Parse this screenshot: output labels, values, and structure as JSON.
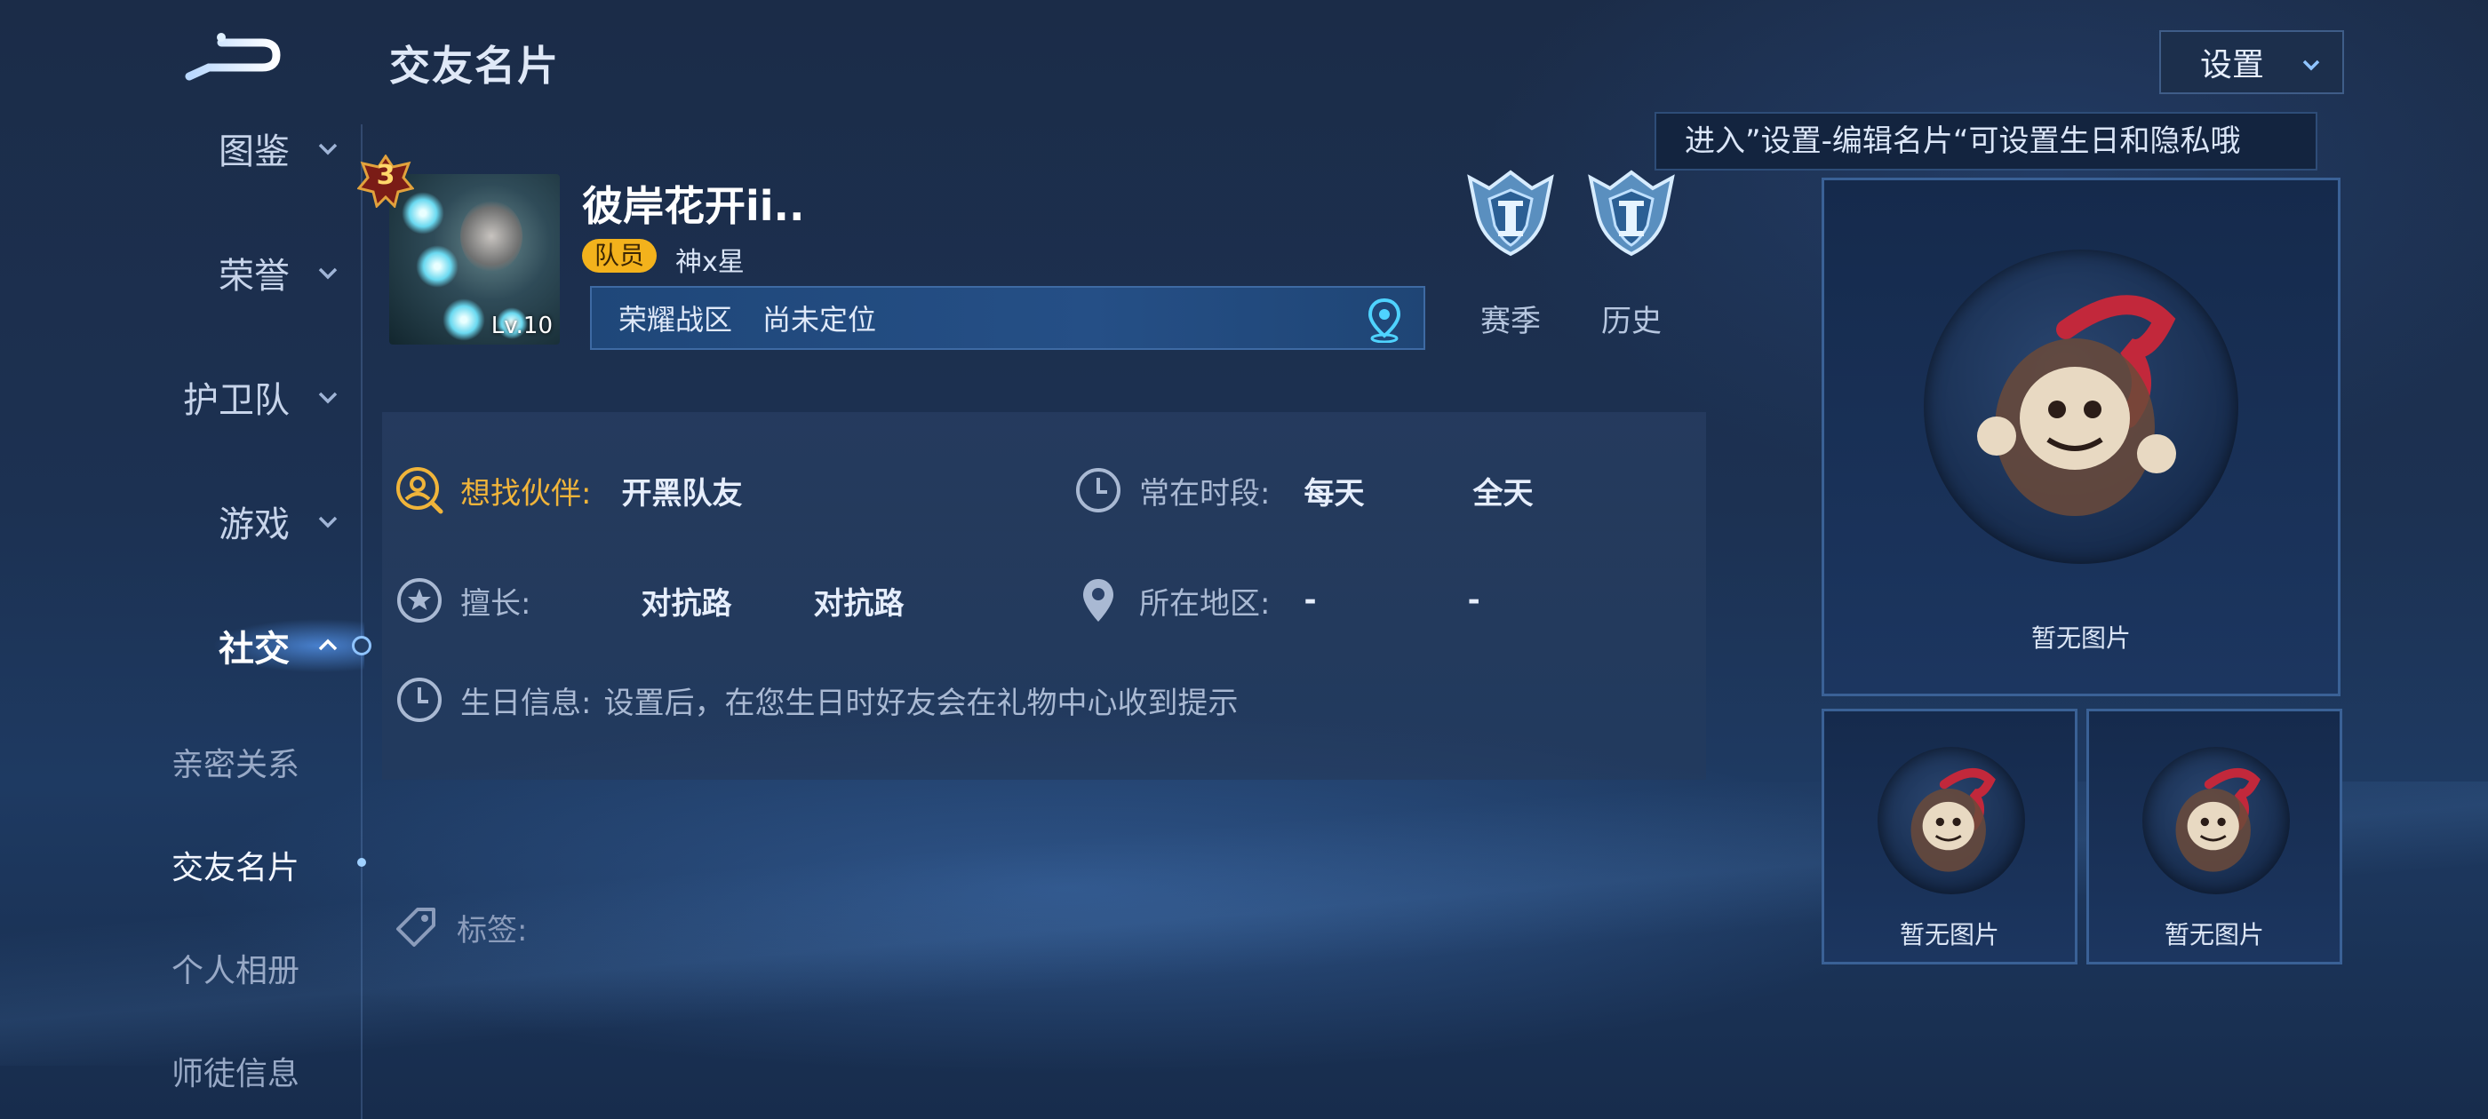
{
  "header": {
    "title": "交友名片"
  },
  "sidebar": {
    "main_items": [
      {
        "label": "图鉴"
      },
      {
        "label": "荣誉"
      },
      {
        "label": "护卫队"
      },
      {
        "label": "游戏"
      },
      {
        "label": "社交"
      }
    ],
    "sub_items": [
      {
        "label": "亲密关系"
      },
      {
        "label": "交友名片"
      },
      {
        "label": "个人相册"
      },
      {
        "label": "师徒信息"
      }
    ]
  },
  "profile": {
    "rank_number": "3",
    "level": "Lv.10",
    "name": "彼岸花开ii..",
    "role_badge": "队员",
    "guild": "神x星",
    "zone_label": "荣耀战区",
    "zone_value": "尚未定位"
  },
  "medals": [
    {
      "label": "赛季"
    },
    {
      "label": "历史"
    }
  ],
  "settings": {
    "button_label": "设置",
    "tip": "进入”设置-编辑名片“可设置生日和隐私哦"
  },
  "info": {
    "partner_key": "想找伙伴:",
    "partner_value": "开黑队友",
    "time_key": "常在时段:",
    "time_value_1": "每天",
    "time_value_2": "全天",
    "skill_key": "擅长:",
    "skill_value_1": "对抗路",
    "skill_value_2": "对抗路",
    "region_key": "所在地区:",
    "region_value_1": "-",
    "region_value_2": "-",
    "birthday_key": "生日信息:",
    "birthday_value": "设置后，在您生日时好友会在礼物中心收到提示",
    "tags_key": "标签:"
  },
  "album": {
    "placeholders": [
      {
        "label": "暂无图片"
      },
      {
        "label": "暂无图片"
      },
      {
        "label": "暂无图片"
      }
    ]
  },
  "colors": {
    "accent_orange": "#f0b43a",
    "badge_yellow": "#f3b21c",
    "background": "#1c3152",
    "border_blue": "#3a6196"
  }
}
